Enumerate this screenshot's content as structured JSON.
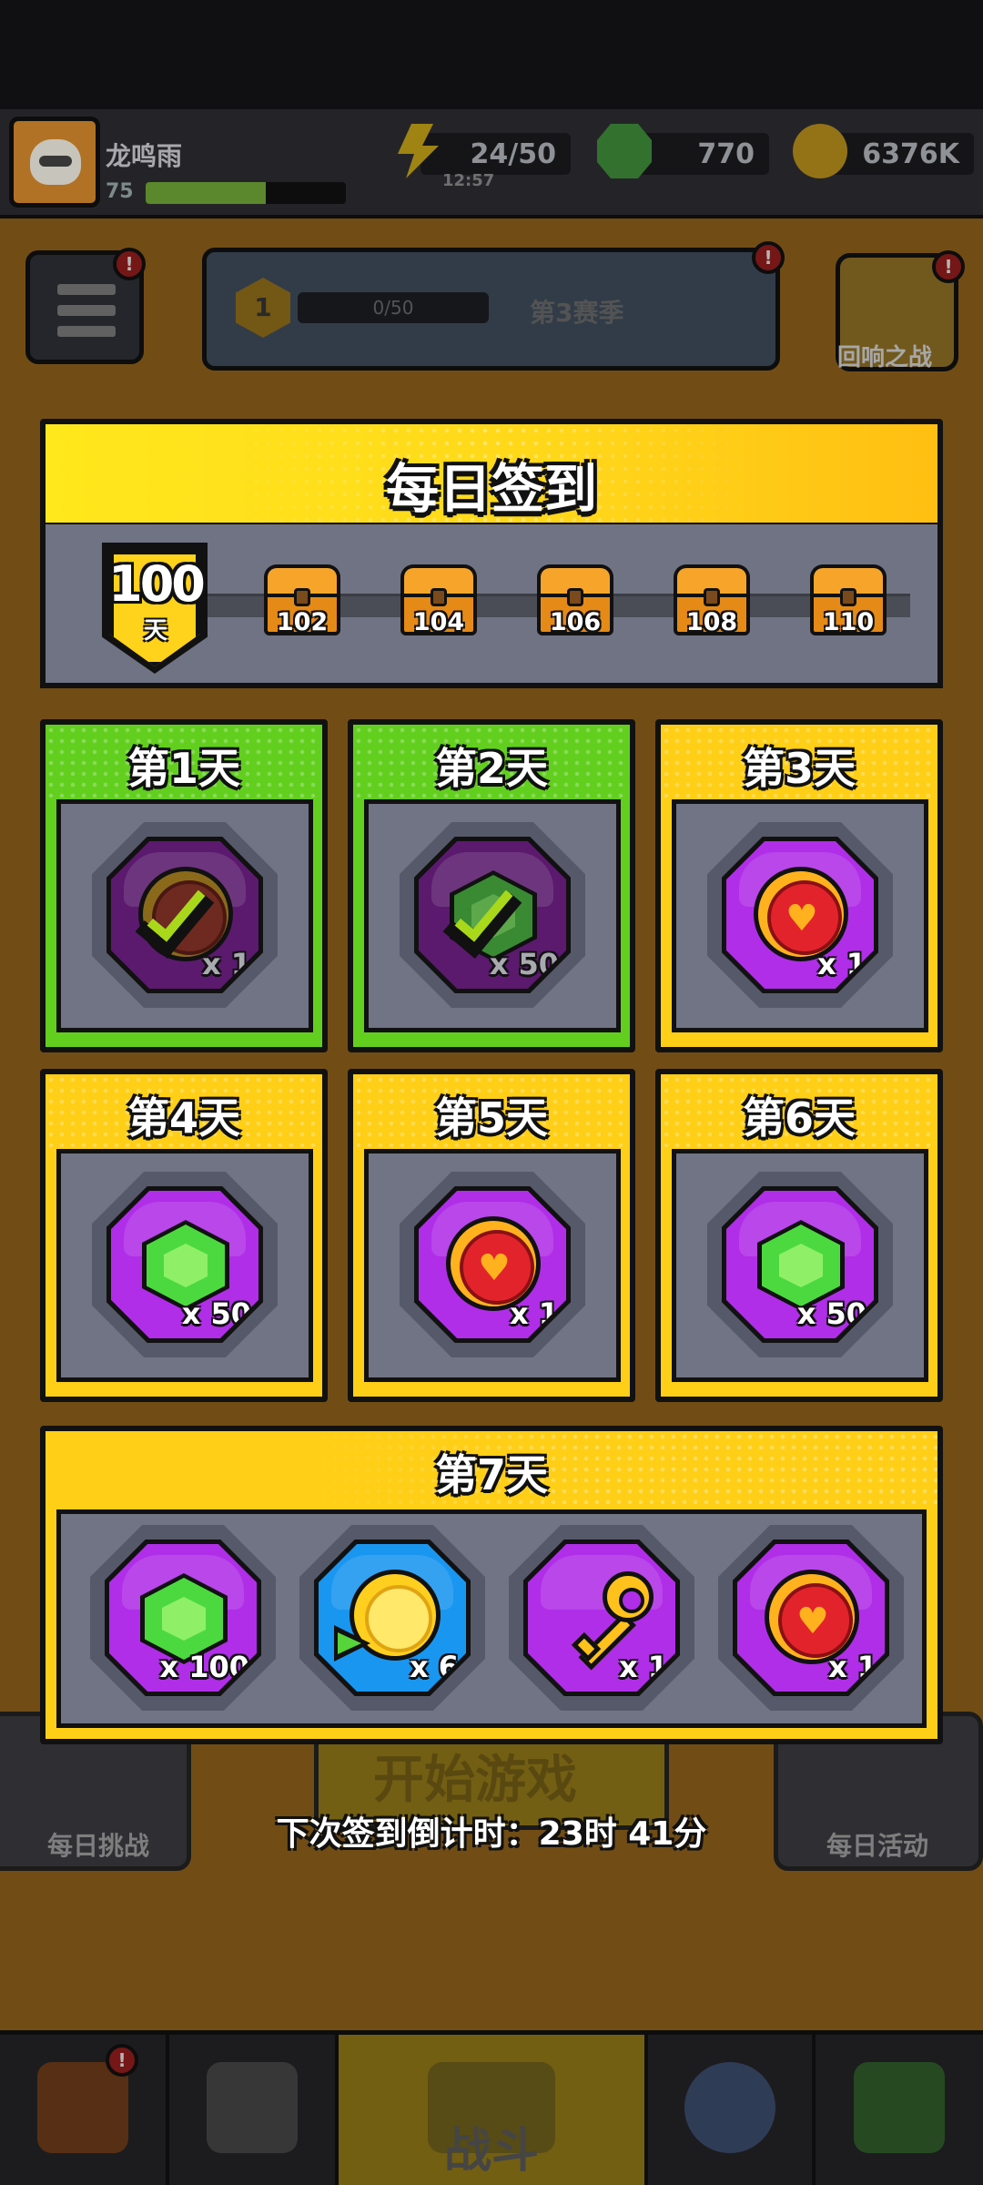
{
  "player": {
    "name": "龙鸣雨",
    "level": "75",
    "xp_fraction": 0.6
  },
  "resources": {
    "energy": {
      "value": "24/50",
      "timer": "12:57",
      "icon": "lightning-icon"
    },
    "gems": {
      "value": "770",
      "icon": "gem-icon"
    },
    "coins": {
      "value": "6376K",
      "icon": "coin-icon"
    }
  },
  "season": {
    "level": "1",
    "progress": "0/50",
    "title": "第3赛季"
  },
  "echo_battle": {
    "label": "回响之战"
  },
  "badges": {
    "alert": "!"
  },
  "dialog": {
    "title": "每日签到",
    "streak": {
      "count": "100",
      "unit": "天"
    },
    "milestones": [
      "102",
      "104",
      "106",
      "108",
      "110"
    ],
    "countdown": "下次签到倒计时：23时 41分"
  },
  "days": [
    {
      "label": "第1天",
      "state": "claimed",
      "item": "check-coin",
      "qty": "x 1"
    },
    {
      "label": "第2天",
      "state": "claimed",
      "item": "gem",
      "qty": "x 50"
    },
    {
      "label": "第3天",
      "state": "pending",
      "item": "heart-coin",
      "qty": "x 1"
    },
    {
      "label": "第4天",
      "state": "pending",
      "item": "gem",
      "qty": "x 50"
    },
    {
      "label": "第5天",
      "state": "pending",
      "item": "heart-coin",
      "qty": "x 1"
    },
    {
      "label": "第6天",
      "state": "pending",
      "item": "gem",
      "qty": "x 50"
    }
  ],
  "day7": {
    "label": "第7天",
    "rewards": [
      {
        "item": "gem",
        "qty": "x 100"
      },
      {
        "item": "gold-coin",
        "qty": "x 6"
      },
      {
        "item": "key",
        "qty": "x 1"
      },
      {
        "item": "heart-coin",
        "qty": "x 1"
      }
    ]
  },
  "background": {
    "daily_challenge": "每日挑战",
    "daily_event": "每日活动",
    "start_game": "开始游戏",
    "nav_battle": "战斗"
  },
  "colors": {
    "claimed_green": "#62cf1f",
    "pending_yellow": "#ffcf18",
    "item_purple": "#b02ee8",
    "gem_green": "#4cd93f"
  }
}
